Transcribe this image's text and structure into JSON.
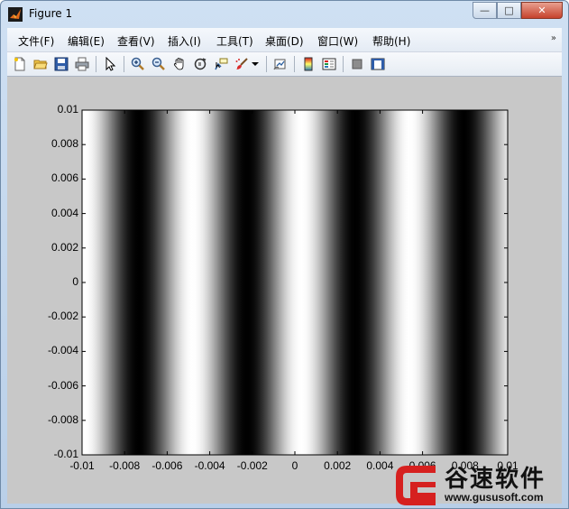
{
  "window": {
    "title": "Figure 1",
    "controls": {
      "minimize": "—",
      "maximize": "□",
      "close": "✕"
    }
  },
  "menubar": {
    "items": [
      "文件(F)",
      "编辑(E)",
      "查看(V)",
      "插入(I)",
      "工具(T)",
      "桌面(D)",
      "窗口(W)",
      "帮助(H)"
    ],
    "more": "»"
  },
  "toolbar": {
    "icons": [
      "new-figure-icon",
      "open-file-icon",
      "save-icon",
      "print-icon",
      "pointer-icon",
      "zoom-in-icon",
      "zoom-out-icon",
      "pan-hand-icon",
      "rotate-3d-icon",
      "data-cursor-icon",
      "brush-icon",
      "brush-dropdown-icon",
      "link-plot-icon",
      "colorbar-icon",
      "legend-icon",
      "hide-plot-tools-icon",
      "show-plot-tools-icon"
    ]
  },
  "chart_data": {
    "type": "heatmap",
    "title": "",
    "xlabel": "",
    "ylabel": "",
    "xlim": [
      -0.01,
      0.01
    ],
    "ylim": [
      -0.01,
      0.01
    ],
    "colormap": "gray",
    "pattern": "vertical cosine fringes, intensity constant along y",
    "bright_centers_x": [
      -0.0099,
      -0.0048,
      0.0003,
      0.0054
    ],
    "dark_centers_x": [
      -0.0074,
      -0.0022,
      0.0029,
      0.008
    ],
    "x_ticks": [
      "-0.01",
      "-0.008",
      "-0.006",
      "-0.004",
      "-0.002",
      "0",
      "0.002",
      "0.004",
      "0.006",
      "0.008",
      "0.01"
    ],
    "y_ticks": [
      "0.01",
      "0.008",
      "0.006",
      "0.004",
      "0.002",
      "0",
      "-0.002",
      "-0.004",
      "-0.006",
      "-0.008",
      "-0.01"
    ],
    "grid": false
  },
  "watermark": {
    "title": "谷速软件",
    "url": "www.gususoft.com"
  }
}
